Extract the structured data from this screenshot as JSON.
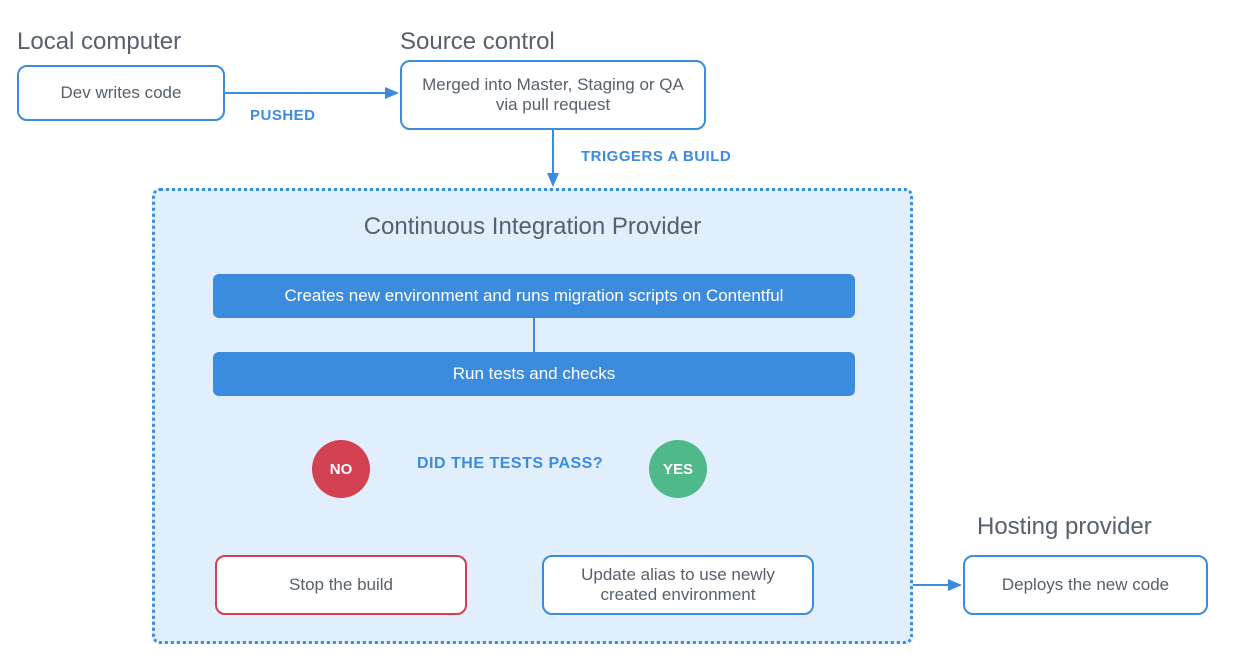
{
  "sections": {
    "local": {
      "title": "Local computer",
      "box": "Dev writes code"
    },
    "source_control": {
      "title": "Source control",
      "box": "Merged into Master, Staging or QA via pull request"
    },
    "hosting": {
      "title": "Hosting provider",
      "box": "Deploys the new code"
    }
  },
  "edges": {
    "pushed": "PUSHED",
    "triggers": "TRIGGERS A BUILD",
    "tests_pass": "DID THE TESTS PASS?"
  },
  "ci": {
    "title": "Continuous Integration Provider",
    "step_env": "Creates new environment and runs migration scripts on Contentful",
    "step_tests": "Run tests and checks",
    "no": "NO",
    "yes": "YES",
    "stop": "Stop the build",
    "update": "Update alias to use newly created environment"
  },
  "colors": {
    "blue": "#3b8cde",
    "red": "#d14152",
    "green": "#4fb98a",
    "panel_bg": "#e1eefb",
    "gray_text": "#4a5560"
  }
}
